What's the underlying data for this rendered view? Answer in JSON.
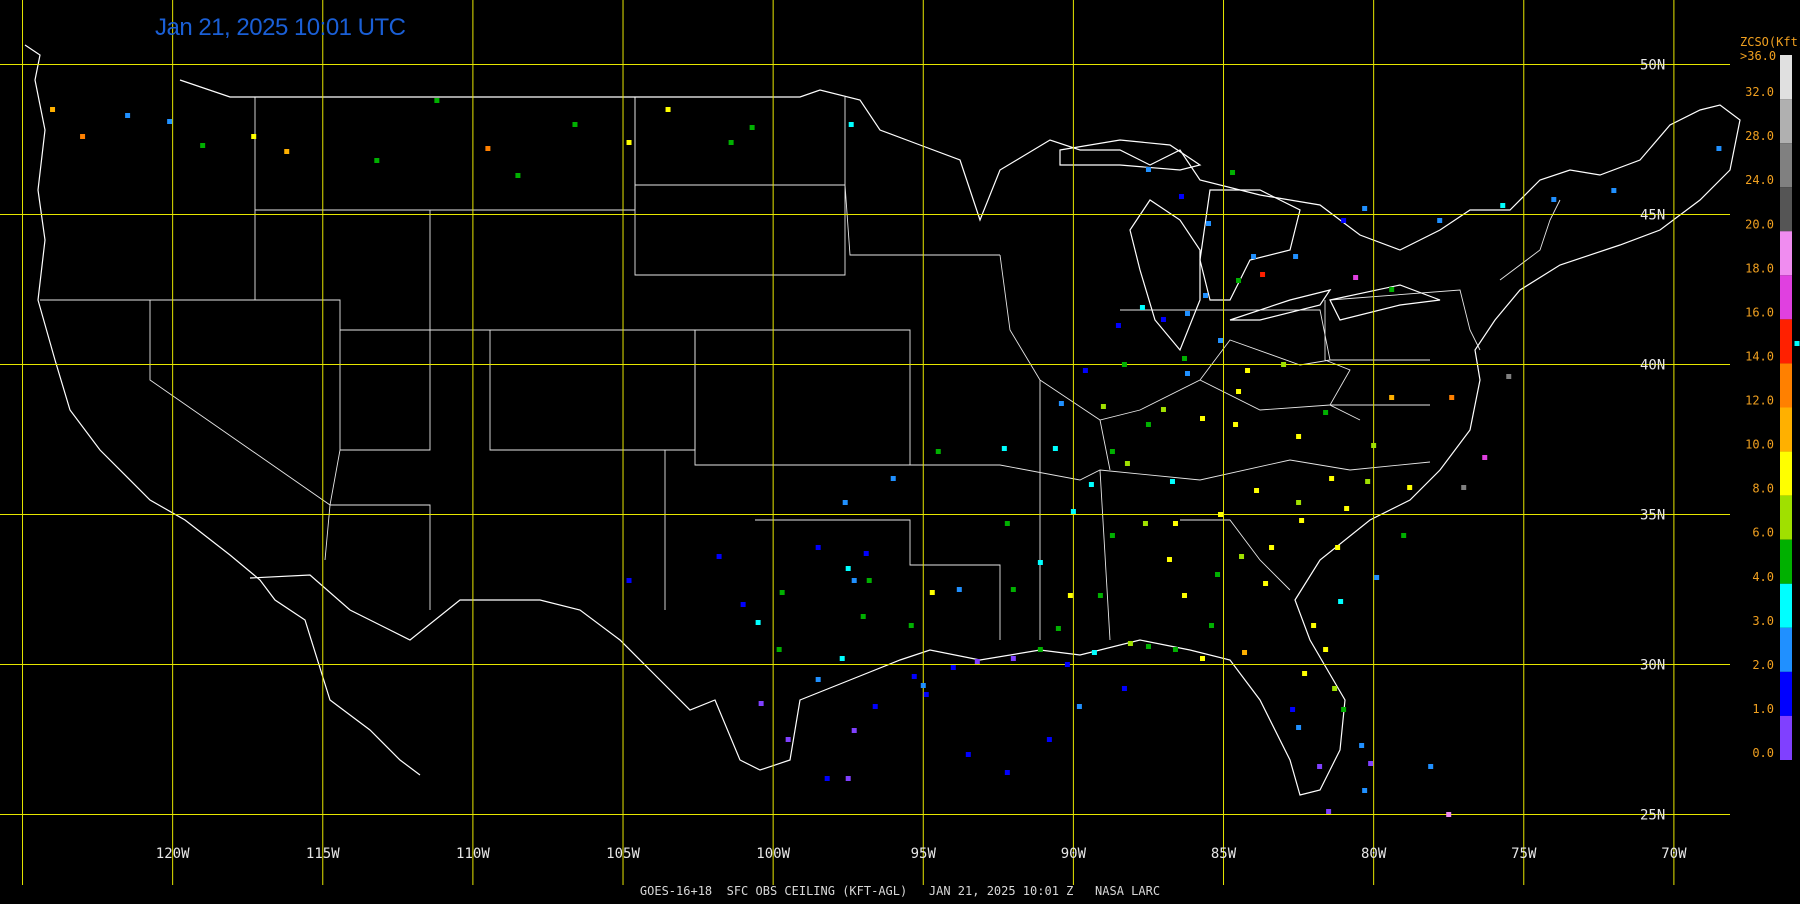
{
  "title": "Jan 21, 2025 10:01 UTC",
  "footer": "GOES-16+18  SFC OBS CEILING (KFT-AGL)   JAN 21, 2025 10:01 Z   NASA LARC",
  "colorbar": {
    "title": "ZCSO(Kft)",
    "top_label": ">36.0",
    "ticks": [
      "32.0",
      "28.0",
      "24.0",
      "20.0",
      "18.0",
      "16.0",
      "14.0",
      "12.0",
      "10.0",
      "8.0",
      "6.0",
      "4.0",
      "3.0",
      "2.0",
      "1.0",
      "0.0"
    ],
    "colors": [
      "#e0e0e0",
      "#b0b0b0",
      "#808080",
      "#555555",
      "#f08cf0",
      "#e040e0",
      "#ff2000",
      "#ff8000",
      "#ffb000",
      "#ffff00",
      "#a0e000",
      "#00b000",
      "#00ffff",
      "#2090ff",
      "#0000ff",
      "#8040ff"
    ]
  },
  "grid": {
    "lon_labels": [
      "120W",
      "115W",
      "110W",
      "105W",
      "100W",
      "95W",
      "90W",
      "85W",
      "80W",
      "75W",
      "70W"
    ],
    "lat_labels": [
      "50N",
      "45N",
      "40N",
      "35N",
      "30N",
      "25N"
    ],
    "line_color": "#e6e600",
    "map_line_color": "#ffffff"
  },
  "map": {
    "lon_range": [
      -125.75,
      -65.8
    ],
    "lat_range": [
      22.15,
      52.15
    ]
  },
  "stations": [
    {
      "lon": -119,
      "lat": 47.3,
      "c": "#00b000"
    },
    {
      "lon": -117.3,
      "lat": 47.6,
      "c": "#ffff00"
    },
    {
      "lon": -116.2,
      "lat": 47.1,
      "c": "#ffb000"
    },
    {
      "lon": -113.2,
      "lat": 46.8,
      "c": "#00b000"
    },
    {
      "lon": -111.2,
      "lat": 48.8,
      "c": "#00b000"
    },
    {
      "lon": -109.5,
      "lat": 47.2,
      "c": "#ff8000"
    },
    {
      "lon": -108.5,
      "lat": 46.3,
      "c": "#00b000"
    },
    {
      "lon": -106.6,
      "lat": 48.0,
      "c": "#00b000"
    },
    {
      "lon": -104.8,
      "lat": 47.4,
      "c": "#ffff00"
    },
    {
      "lon": -103.5,
      "lat": 48.5,
      "c": "#ffff00"
    },
    {
      "lon": -101.4,
      "lat": 47.4,
      "c": "#00b000"
    },
    {
      "lon": -100.7,
      "lat": 47.9,
      "c": "#00b000"
    },
    {
      "lon": -97.4,
      "lat": 48.0,
      "c": "#00ffff"
    },
    {
      "lon": -123.0,
      "lat": 47.6,
      "c": "#ff8000"
    },
    {
      "lon": -124.0,
      "lat": 48.5,
      "c": "#ffb000"
    },
    {
      "lon": -121.5,
      "lat": 48.3,
      "c": "#2090ff"
    },
    {
      "lon": -120.1,
      "lat": 48.1,
      "c": "#2090ff"
    },
    {
      "lon": -87.5,
      "lat": 46.5,
      "c": "#2090ff"
    },
    {
      "lon": -86.4,
      "lat": 45.6,
      "c": "#0000ff"
    },
    {
      "lon": -85.5,
      "lat": 44.7,
      "c": "#2090ff"
    },
    {
      "lon": -84.7,
      "lat": 46.4,
      "c": "#00b000"
    },
    {
      "lon": -84.0,
      "lat": 43.6,
      "c": "#2090ff"
    },
    {
      "lon": -83.7,
      "lat": 43.0,
      "c": "#ff2000"
    },
    {
      "lon": -84.5,
      "lat": 42.8,
      "c": "#00b000"
    },
    {
      "lon": -85.6,
      "lat": 42.3,
      "c": "#2090ff"
    },
    {
      "lon": -86.2,
      "lat": 41.7,
      "c": "#2090ff"
    },
    {
      "lon": -87.0,
      "lat": 41.5,
      "c": "#0000ff"
    },
    {
      "lon": -87.7,
      "lat": 41.9,
      "c": "#00ffff"
    },
    {
      "lon": -88.5,
      "lat": 41.3,
      "c": "#0000ff"
    },
    {
      "lon": -86.3,
      "lat": 40.2,
      "c": "#00b000"
    },
    {
      "lon": -85.1,
      "lat": 40.8,
      "c": "#2090ff"
    },
    {
      "lon": -84.2,
      "lat": 39.8,
      "c": "#ffff00"
    },
    {
      "lon": -83.0,
      "lat": 40.0,
      "c": "#a0e000"
    },
    {
      "lon": -84.5,
      "lat": 39.1,
      "c": "#ffff00"
    },
    {
      "lon": -86.2,
      "lat": 39.7,
      "c": "#2090ff"
    },
    {
      "lon": -87.5,
      "lat": 38.0,
      "c": "#00b000"
    },
    {
      "lon": -85.7,
      "lat": 38.2,
      "c": "#ffff00"
    },
    {
      "lon": -84.6,
      "lat": 38.0,
      "c": "#ffff00"
    },
    {
      "lon": -82.5,
      "lat": 37.6,
      "c": "#ffff00"
    },
    {
      "lon": -81.6,
      "lat": 38.4,
      "c": "#00b000"
    },
    {
      "lon": -80.0,
      "lat": 37.3,
      "c": "#a0e000"
    },
    {
      "lon": -79.4,
      "lat": 38.9,
      "c": "#ffb000"
    },
    {
      "lon": -77.4,
      "lat": 38.9,
      "c": "#ff8000"
    },
    {
      "lon": -75.5,
      "lat": 39.6,
      "c": "#808080"
    },
    {
      "lon": -76.3,
      "lat": 36.9,
      "c": "#e040e0"
    },
    {
      "lon": -77.0,
      "lat": 35.9,
      "c": "#808080"
    },
    {
      "lon": -78.8,
      "lat": 35.9,
      "c": "#ffff00"
    },
    {
      "lon": -80.2,
      "lat": 36.1,
      "c": "#a0e000"
    },
    {
      "lon": -81.4,
      "lat": 36.2,
      "c": "#ffff00"
    },
    {
      "lon": -82.5,
      "lat": 35.4,
      "c": "#a0e000"
    },
    {
      "lon": -80.9,
      "lat": 35.2,
      "c": "#ffff00"
    },
    {
      "lon": -79.0,
      "lat": 34.3,
      "c": "#00b000"
    },
    {
      "lon": -79.9,
      "lat": 32.9,
      "c": "#2090ff"
    },
    {
      "lon": -81.1,
      "lat": 32.1,
      "c": "#00ffff"
    },
    {
      "lon": -81.2,
      "lat": 33.9,
      "c": "#ffff00"
    },
    {
      "lon": -82.4,
      "lat": 34.8,
      "c": "#ffff00"
    },
    {
      "lon": -83.4,
      "lat": 33.9,
      "c": "#ffff00"
    },
    {
      "lon": -84.4,
      "lat": 33.6,
      "c": "#a0e000"
    },
    {
      "lon": -85.2,
      "lat": 33.0,
      "c": "#00b000"
    },
    {
      "lon": -83.6,
      "lat": 32.7,
      "c": "#ffff00"
    },
    {
      "lon": -82.0,
      "lat": 31.3,
      "c": "#ffff00"
    },
    {
      "lon": -81.6,
      "lat": 30.5,
      "c": "#ffff00"
    },
    {
      "lon": -82.3,
      "lat": 29.7,
      "c": "#ffff00"
    },
    {
      "lon": -81.3,
      "lat": 29.2,
      "c": "#a0e000"
    },
    {
      "lon": -81.0,
      "lat": 28.5,
      "c": "#00b000"
    },
    {
      "lon": -82.5,
      "lat": 27.9,
      "c": "#2090ff"
    },
    {
      "lon": -82.7,
      "lat": 28.5,
      "c": "#0000ff"
    },
    {
      "lon": -81.8,
      "lat": 26.6,
      "c": "#8040ff"
    },
    {
      "lon": -80.3,
      "lat": 25.8,
      "c": "#2090ff"
    },
    {
      "lon": -80.1,
      "lat": 26.7,
      "c": "#8040ff"
    },
    {
      "lon": -81.5,
      "lat": 25.1,
      "c": "#8040ff"
    },
    {
      "lon": -80.4,
      "lat": 27.3,
      "c": "#2090ff"
    },
    {
      "lon": -84.3,
      "lat": 30.4,
      "c": "#ffb000"
    },
    {
      "lon": -85.7,
      "lat": 30.2,
      "c": "#ffff00"
    },
    {
      "lon": -86.6,
      "lat": 30.5,
      "c": "#00b000"
    },
    {
      "lon": -87.5,
      "lat": 30.6,
      "c": "#00b000"
    },
    {
      "lon": -88.1,
      "lat": 30.7,
      "c": "#a0e000"
    },
    {
      "lon": -86.8,
      "lat": 33.5,
      "c": "#ffff00"
    },
    {
      "lon": -86.3,
      "lat": 32.3,
      "c": "#ffff00"
    },
    {
      "lon": -85.4,
      "lat": 31.3,
      "c": "#00b000"
    },
    {
      "lon": -87.6,
      "lat": 34.7,
      "c": "#a0e000"
    },
    {
      "lon": -86.6,
      "lat": 34.7,
      "c": "#ffff00"
    },
    {
      "lon": -88.7,
      "lat": 34.3,
      "c": "#00b000"
    },
    {
      "lon": -89.1,
      "lat": 32.3,
      "c": "#00b000"
    },
    {
      "lon": -90.1,
      "lat": 32.3,
      "c": "#ffff00"
    },
    {
      "lon": -90.5,
      "lat": 31.2,
      "c": "#00b000"
    },
    {
      "lon": -89.3,
      "lat": 30.4,
      "c": "#00ffff"
    },
    {
      "lon": -90.2,
      "lat": 30.0,
      "c": "#0000ff"
    },
    {
      "lon": -91.1,
      "lat": 30.5,
      "c": "#00b000"
    },
    {
      "lon": -92.0,
      "lat": 30.2,
      "c": "#8040ff"
    },
    {
      "lon": -93.2,
      "lat": 30.1,
      "c": "#8040ff"
    },
    {
      "lon": -94.0,
      "lat": 29.9,
      "c": "#0000ff"
    },
    {
      "lon": -95.3,
      "lat": 29.6,
      "c": "#0000ff"
    },
    {
      "lon": -95.0,
      "lat": 29.3,
      "c": "#2090ff"
    },
    {
      "lon": -96.6,
      "lat": 28.6,
      "c": "#0000ff"
    },
    {
      "lon": -97.3,
      "lat": 27.8,
      "c": "#8040ff"
    },
    {
      "lon": -97.5,
      "lat": 26.2,
      "c": "#8040ff"
    },
    {
      "lon": -98.2,
      "lat": 26.2,
      "c": "#0000ff"
    },
    {
      "lon": -99.5,
      "lat": 27.5,
      "c": "#8040ff"
    },
    {
      "lon": -100.4,
      "lat": 28.7,
      "c": "#8040ff"
    },
    {
      "lon": -98.5,
      "lat": 29.5,
      "c": "#2090ff"
    },
    {
      "lon": -97.7,
      "lat": 30.2,
      "c": "#00ffff"
    },
    {
      "lon": -97.0,
      "lat": 31.6,
      "c": "#00b000"
    },
    {
      "lon": -96.8,
      "lat": 32.8,
      "c": "#00b000"
    },
    {
      "lon": -97.3,
      "lat": 32.8,
      "c": "#2090ff"
    },
    {
      "lon": -98.5,
      "lat": 33.9,
      "c": "#0000ff"
    },
    {
      "lon": -97.5,
      "lat": 33.2,
      "c": "#00ffff"
    },
    {
      "lon": -99.7,
      "lat": 32.4,
      "c": "#00b000"
    },
    {
      "lon": -100.5,
      "lat": 31.4,
      "c": "#00ffff"
    },
    {
      "lon": -101.8,
      "lat": 33.6,
      "c": "#0000ff"
    },
    {
      "lon": -99.8,
      "lat": 30.5,
      "c": "#00b000"
    },
    {
      "lon": -95.4,
      "lat": 31.3,
      "c": "#00b000"
    },
    {
      "lon": -94.7,
      "lat": 32.4,
      "c": "#ffff00"
    },
    {
      "lon": -93.8,
      "lat": 32.5,
      "c": "#2090ff"
    },
    {
      "lon": -92.0,
      "lat": 32.5,
      "c": "#00b000"
    },
    {
      "lon": -91.1,
      "lat": 33.4,
      "c": "#00ffff"
    },
    {
      "lon": -92.2,
      "lat": 34.7,
      "c": "#00b000"
    },
    {
      "lon": -90.0,
      "lat": 35.1,
      "c": "#00ffff"
    },
    {
      "lon": -90.6,
      "lat": 37.2,
      "c": "#00ffff"
    },
    {
      "lon": -92.3,
      "lat": 37.2,
      "c": "#00ffff"
    },
    {
      "lon": -94.5,
      "lat": 37.1,
      "c": "#00b000"
    },
    {
      "lon": -96.9,
      "lat": 33.7,
      "c": "#0000ff"
    },
    {
      "lon": -96.0,
      "lat": 36.2,
      "c": "#2090ff"
    },
    {
      "lon": -97.6,
      "lat": 35.4,
      "c": "#2090ff"
    },
    {
      "lon": -104.8,
      "lat": 32.8,
      "c": "#0000ff"
    },
    {
      "lon": -101.0,
      "lat": 32.0,
      "c": "#0000ff"
    },
    {
      "lon": -88.2,
      "lat": 36.7,
      "c": "#a0e000"
    },
    {
      "lon": -86.7,
      "lat": 36.1,
      "c": "#00ffff"
    },
    {
      "lon": -85.1,
      "lat": 35.0,
      "c": "#ffff00"
    },
    {
      "lon": -83.9,
      "lat": 35.8,
      "c": "#ffff00"
    },
    {
      "lon": -89.4,
      "lat": 36.0,
      "c": "#00ffff"
    },
    {
      "lon": -89.6,
      "lat": 39.8,
      "c": "#0000ff"
    },
    {
      "lon": -88.3,
      "lat": 40.0,
      "c": "#00b000"
    },
    {
      "lon": -89.0,
      "lat": 38.6,
      "c": "#a0e000"
    },
    {
      "lon": -90.4,
      "lat": 38.7,
      "c": "#2090ff"
    },
    {
      "lon": -88.7,
      "lat": 37.1,
      "c": "#00b000"
    },
    {
      "lon": -87.0,
      "lat": 38.5,
      "c": "#a0e000"
    },
    {
      "lon": -94.9,
      "lat": 29.0,
      "c": "#0000ff"
    },
    {
      "lon": -93.5,
      "lat": 27.0,
      "c": "#0000ff"
    },
    {
      "lon": -90.8,
      "lat": 27.5,
      "c": "#0000ff"
    },
    {
      "lon": -92.2,
      "lat": 26.4,
      "c": "#0000ff"
    },
    {
      "lon": -89.8,
      "lat": 28.6,
      "c": "#2090ff"
    },
    {
      "lon": -88.3,
      "lat": 29.2,
      "c": "#0000ff"
    },
    {
      "lon": -78.1,
      "lat": 26.6,
      "c": "#2090ff"
    },
    {
      "lon": -77.5,
      "lat": 25.0,
      "c": "#f08cf0"
    },
    {
      "lon": -77.8,
      "lat": 44.8,
      "c": "#2090ff"
    },
    {
      "lon": -80.3,
      "lat": 45.2,
      "c": "#2090ff"
    },
    {
      "lon": -81.0,
      "lat": 44.8,
      "c": "#0000ff"
    },
    {
      "lon": -82.6,
      "lat": 43.6,
      "c": "#2090ff"
    },
    {
      "lon": -79.4,
      "lat": 42.5,
      "c": "#00b000"
    },
    {
      "lon": -80.6,
      "lat": 42.9,
      "c": "#e040e0"
    },
    {
      "lon": -75.7,
      "lat": 45.3,
      "c": "#00ffff"
    },
    {
      "lon": -74.0,
      "lat": 45.5,
      "c": "#2090ff"
    },
    {
      "lon": -72.0,
      "lat": 45.8,
      "c": "#2090ff"
    },
    {
      "lon": -68.5,
      "lat": 47.2,
      "c": "#2090ff"
    },
    {
      "lon": -66.2,
      "lat": 44.2,
      "c": "#2090ff"
    },
    {
      "lon": -65.9,
      "lat": 40.7,
      "c": "#00ffff"
    }
  ]
}
